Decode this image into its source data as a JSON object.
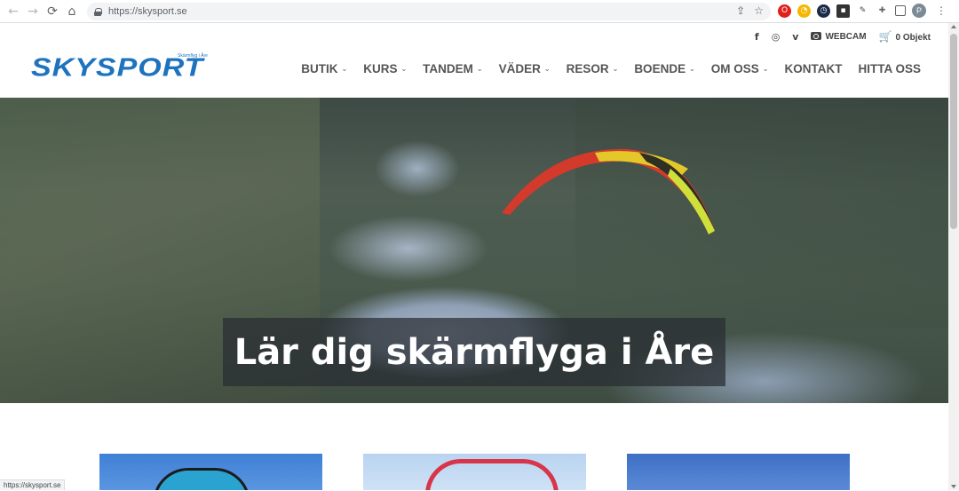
{
  "browser": {
    "url": "https://skysport.se",
    "status_url": "https://skysport.se",
    "nav_glyphs": {
      "back": "←",
      "forward": "→",
      "reload": "⟳",
      "home": "⌂"
    },
    "profile_initial": "P",
    "icons": [
      "share-icon",
      "bookmark-star-icon",
      "extension-icons",
      "puzzle-icon",
      "menu-icon"
    ]
  },
  "header": {
    "logo_text": "SKYSPORT",
    "logo_sub": "Skärmflyg i Åre",
    "webcam_label": "WEBCAM",
    "cart_label": "0 Objekt",
    "social_icons": [
      "facebook-icon",
      "instagram-icon",
      "vimeo-icon"
    ],
    "nav": [
      {
        "label": "BUTIK",
        "dropdown": true
      },
      {
        "label": "KURS",
        "dropdown": true
      },
      {
        "label": "TANDEM",
        "dropdown": true
      },
      {
        "label": "VÄDER",
        "dropdown": true
      },
      {
        "label": "RESOR",
        "dropdown": true
      },
      {
        "label": "BOENDE",
        "dropdown": true
      },
      {
        "label": "OM OSS",
        "dropdown": true
      },
      {
        "label": "KONTAKT",
        "dropdown": false
      },
      {
        "label": "HITTA OSS",
        "dropdown": false
      }
    ],
    "brand_color": "#1e73be"
  },
  "hero": {
    "caption": "Lär dig skärmflyga i Åre"
  },
  "cards": [
    {
      "name": "card-1"
    },
    {
      "name": "card-2"
    },
    {
      "name": "card-3"
    }
  ]
}
